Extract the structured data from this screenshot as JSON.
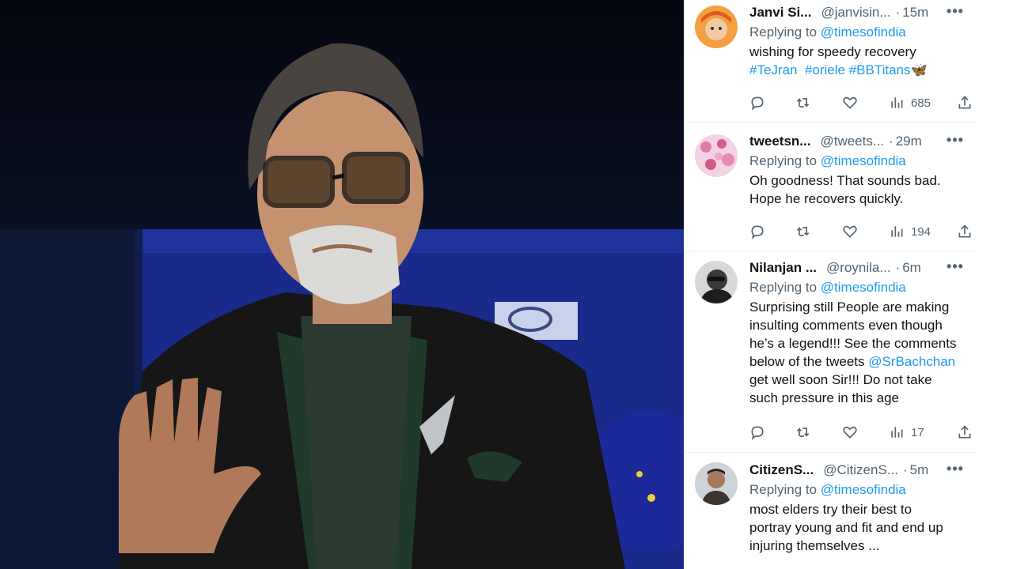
{
  "photo": {
    "alt_subject": "man with grey beard and glasses waving"
  },
  "colors": {
    "link": "#1d9bf0",
    "secondary": "#536471",
    "primary_text": "#0f1419"
  },
  "replies": [
    {
      "name": "Janvi Si...",
      "handle": "@janvisin...",
      "time": "15m",
      "replying_prefix": "Replying to ",
      "replying_to": "@timesofindia",
      "text_line1": "wishing for speedy recovery",
      "hashtags": [
        "#TeJran",
        "#oriele",
        "#BBTitans"
      ],
      "emoji": "🦋",
      "views": "685",
      "avatar_icon": "avatar-orange-cartoon"
    },
    {
      "name": "tweetsn...",
      "handle": "@tweets...",
      "time": "29m",
      "replying_prefix": "Replying to ",
      "replying_to": "@timesofindia",
      "text_line1": "Oh goodness! That sounds bad.",
      "text_line2": "Hope he recovers quickly.",
      "views": "194",
      "avatar_icon": "avatar-pink-flowers"
    },
    {
      "name": "Nilanjan ...",
      "handle": "@roynila...",
      "time": "6m",
      "replying_prefix": "Replying to ",
      "replying_to": "@timesofindia",
      "text_line1": "Surprising still People are making",
      "text_line2": "insulting comments even though",
      "text_line3": "he’s a legend!!! See the comments",
      "text_line4_prefix": "below of the tweets ",
      "text_line4_mention": "@SrBachchan",
      "text_line5": "get well soon Sir!!! Do not take",
      "text_line6": "such pressure in this age",
      "views": "17",
      "avatar_icon": "avatar-bw-man"
    },
    {
      "name": "CitizenS...",
      "handle": "@CitizenS...",
      "time": "5m",
      "replying_prefix": "Replying to ",
      "replying_to": "@timesofindia",
      "text_line1": "most elders try their best to",
      "text_line2": "portray young and fit and end up",
      "text_line3": "injuring themselves ...",
      "avatar_icon": "avatar-man-portrait"
    }
  ],
  "separator": "·",
  "more_glyph": "•••"
}
